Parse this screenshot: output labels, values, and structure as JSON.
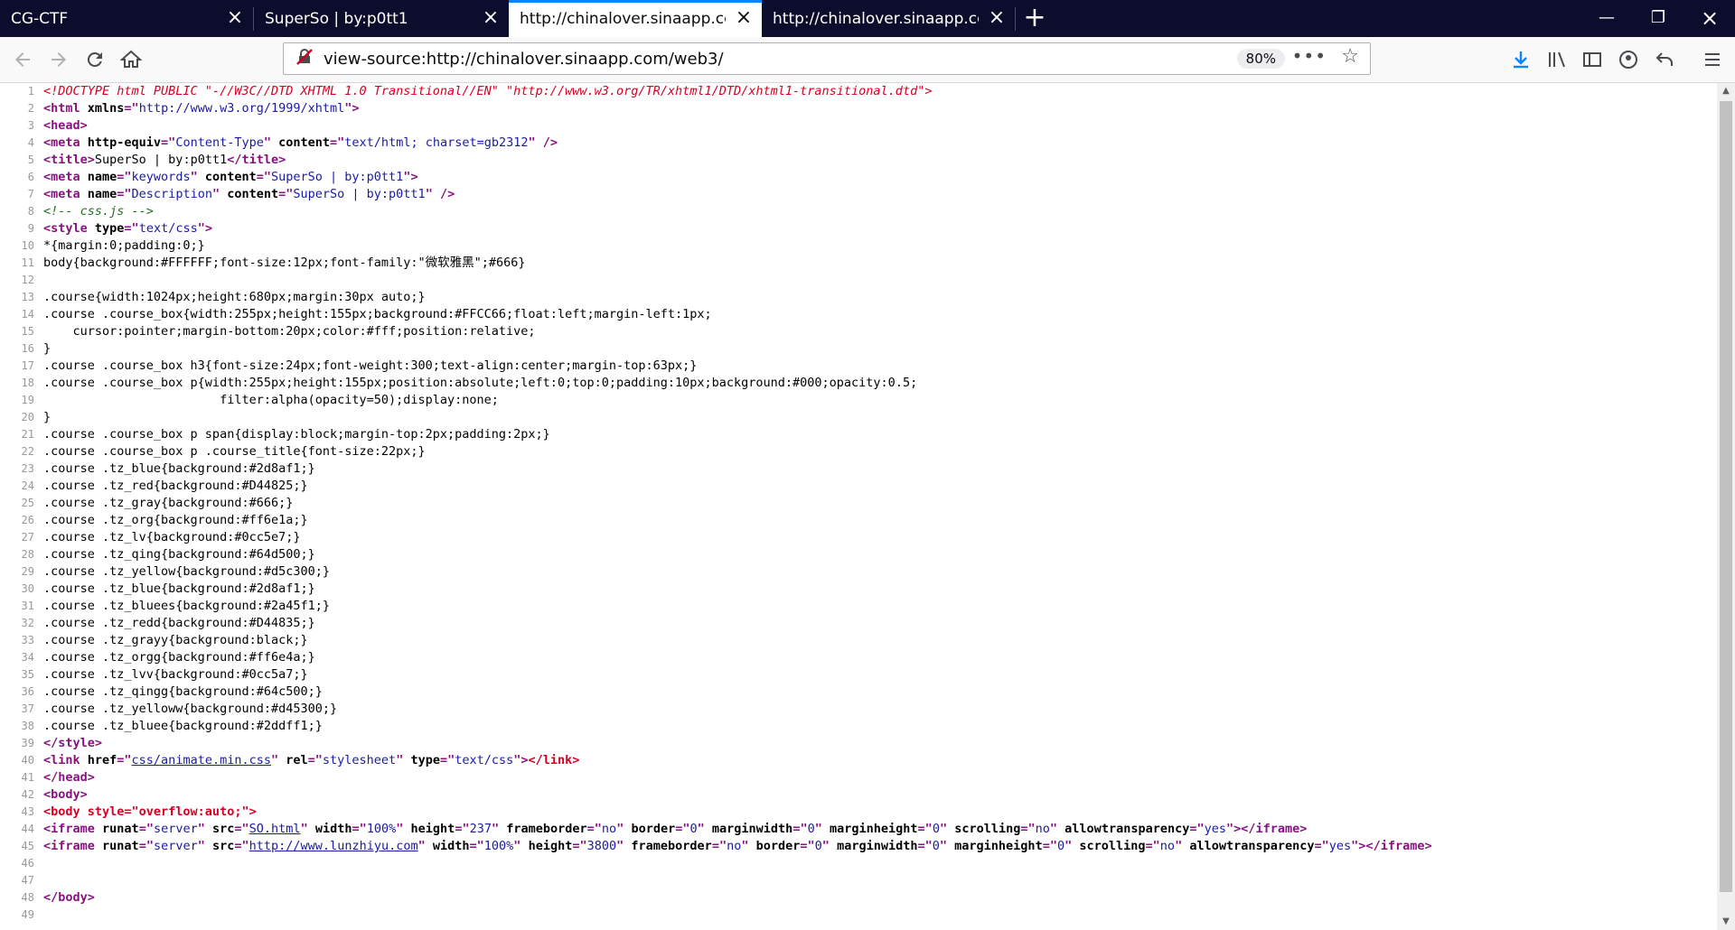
{
  "tabs": [
    {
      "label": "CG-CTF",
      "active": false
    },
    {
      "label": "SuperSo | by:p0tt1",
      "active": false
    },
    {
      "label": "http://chinalover.sinaapp.com/w",
      "active": true
    },
    {
      "label": "http://chinalover.sinaapp.com/w",
      "active": false
    }
  ],
  "toolbar": {
    "url": "view-source:http://chinalover.sinaapp.com/web3/",
    "zoom": "80%",
    "back_icon": "arrow-left-icon",
    "forward_icon": "arrow-right-icon",
    "reload_icon": "reload-icon",
    "home_icon": "home-icon"
  },
  "source_lines": [
    {
      "n": "1"
    },
    {
      "n": "2"
    },
    {
      "n": "3"
    },
    {
      "n": "4"
    },
    {
      "n": "5"
    },
    {
      "n": "6"
    },
    {
      "n": "7"
    },
    {
      "n": "8"
    },
    {
      "n": "9"
    },
    {
      "n": "10"
    },
    {
      "n": "11"
    },
    {
      "n": "12"
    },
    {
      "n": "13"
    },
    {
      "n": "14"
    },
    {
      "n": "15"
    },
    {
      "n": "16"
    },
    {
      "n": "17"
    },
    {
      "n": "18"
    },
    {
      "n": "19"
    },
    {
      "n": "20"
    },
    {
      "n": "21"
    },
    {
      "n": "22"
    },
    {
      "n": "23"
    },
    {
      "n": "24"
    },
    {
      "n": "25"
    },
    {
      "n": "26"
    },
    {
      "n": "27"
    },
    {
      "n": "28"
    },
    {
      "n": "29"
    },
    {
      "n": "30"
    },
    {
      "n": "31"
    },
    {
      "n": "32"
    },
    {
      "n": "33"
    },
    {
      "n": "34"
    },
    {
      "n": "35"
    },
    {
      "n": "36"
    },
    {
      "n": "37"
    },
    {
      "n": "38"
    },
    {
      "n": "39"
    },
    {
      "n": "40"
    },
    {
      "n": "41"
    },
    {
      "n": "42"
    },
    {
      "n": "43"
    },
    {
      "n": "44"
    },
    {
      "n": "45"
    },
    {
      "n": "46"
    },
    {
      "n": "47"
    },
    {
      "n": "48"
    },
    {
      "n": "49"
    }
  ],
  "code": {
    "l1": "<!DOCTYPE html PUBLIC \"-//W3C//DTD XHTML 1.0 Transitional//EN\" \"http://www.w3.org/TR/xhtml1/DTD/xhtml1-transitional.dtd\">",
    "l2_a": "<html",
    "l2_b": " xmlns",
    "l2_c": "=\"",
    "l2_d": "http://www.w3.org/1999/xhtml",
    "l2_e": "\">",
    "l3": "<head>",
    "l4_a": "<meta",
    "l4_b": " http-equiv",
    "l4_c": "=\"",
    "l4_d": "Content-Type",
    "l4_e": "\"",
    "l4_f": " content",
    "l4_g": "=\"",
    "l4_h": "text/html; charset=gb2312",
    "l4_i": "\" />",
    "l5_a": "<title>",
    "l5_b": "SuperSo | by:p0tt1",
    "l5_c": "</title>",
    "l6_a": "<meta",
    "l6_b": " name",
    "l6_c": "=\"",
    "l6_d": "keywords",
    "l6_e": "\"",
    "l6_f": " content",
    "l6_g": "=\"",
    "l6_h": "SuperSo | by:p0tt1",
    "l6_i": "\">",
    "l7_a": "<meta",
    "l7_b": " name",
    "l7_c": "=\"",
    "l7_d": "Description",
    "l7_e": "\"",
    "l7_f": " content",
    "l7_g": "=\"",
    "l7_h": "SuperSo | by:p0tt1",
    "l7_i": "\" />",
    "l8": "<!-- css.js -->",
    "l9_a": "<style",
    "l9_b": " type",
    "l9_c": "=\"",
    "l9_d": "text/css",
    "l9_e": "\">",
    "l10": "*{margin:0;padding:0;}",
    "l11": "body{background:#FFFFFF;font-size:12px;font-family:\"微软雅黑\";#666}",
    "l13": ".course{width:1024px;height:680px;margin:30px auto;}",
    "l14": ".course .course_box{width:255px;height:155px;background:#FFCC66;float:left;margin-left:1px;",
    "l15": "    cursor:pointer;margin-bottom:20px;color:#fff;position:relative;",
    "l16": "}",
    "l17": ".course .course_box h3{font-size:24px;font-weight:300;text-align:center;margin-top:63px;}",
    "l18": ".course .course_box p{width:255px;height:155px;position:absolute;left:0;top:0;padding:10px;background:#000;opacity:0.5;",
    "l19": "                        filter:alpha(opacity=50);display:none;",
    "l20": "}",
    "l21": ".course .course_box p span{display:block;margin-top:2px;padding:2px;}",
    "l22": ".course .course_box p .course_title{font-size:22px;}",
    "l23": ".course .tz_blue{background:#2d8af1;}",
    "l24": ".course .tz_red{background:#D44825;}",
    "l25": ".course .tz_gray{background:#666;}",
    "l26": ".course .tz_org{background:#ff6e1a;}",
    "l27": ".course .tz_lv{background:#0cc5e7;}",
    "l28": ".course .tz_qing{background:#64d500;}",
    "l29": ".course .tz_yellow{background:#d5c300;}",
    "l30": ".course .tz_blue{background:#2d8af1;}",
    "l31": ".course .tz_bluees{background:#2a45f1;}",
    "l32": ".course .tz_redd{background:#D44835;}",
    "l33": ".course .tz_grayy{background:black;}",
    "l34": ".course .tz_orgg{background:#ff6e4a;}",
    "l35": ".course .tz_lvv{background:#0cc5a7;}",
    "l36": ".course .tz_qingg{background:#64c500;}",
    "l37": ".course .tz_yelloww{background:#d45300;}",
    "l38": ".course .tz_bluee{background:#2ddff1;}",
    "l39": "</style>",
    "l40_a": "<link",
    "l40_b": " href",
    "l40_c": "=\"",
    "l40_d": "css/animate.min.css",
    "l40_e": "\"",
    "l40_f": " rel",
    "l40_g": "=\"",
    "l40_h": "stylesheet",
    "l40_i": "\"",
    "l40_j": " type",
    "l40_k": "=\"",
    "l40_l": "text/css",
    "l40_m": "\">",
    "l40_n": "</link>",
    "l41": "</head>",
    "l42": "<body>",
    "l43": "<body style=\"overflow:auto;\">",
    "l44_a": "<iframe",
    "l44_b": " runat",
    "l44_c": "=\"",
    "l44_d": "server",
    "l44_e": "\"",
    "l44_f": " src",
    "l44_g": "=\"",
    "l44_h": "SO.html",
    "l44_i": "\"",
    "l44_j": " width",
    "l44_k": "=\"",
    "l44_l": "100%",
    "l44_m": "\"",
    "l44_n": " height",
    "l44_o": "=\"",
    "l44_p": "237",
    "l44_q": "\"",
    "l44_r": " frameborder",
    "l44_s": "=\"",
    "l44_t": "no",
    "l44_u": "\"",
    "l44_v": " border",
    "l44_w": "=\"",
    "l44_x": "0",
    "l44_y": "\"",
    "l44_z": " marginwidth",
    "l44_aa": "=\"",
    "l44_ab": "0",
    "l44_ac": "\"",
    "l44_ad": " marginheight",
    "l44_ae": "=\"",
    "l44_af": "0",
    "l44_ag": "\"",
    "l44_ah": " scrolling",
    "l44_ai": "=\"",
    "l44_aj": "no",
    "l44_ak": "\"",
    "l44_al": " allowtransparency",
    "l44_am": "=\"",
    "l44_an": "yes",
    "l44_ao": "\">",
    "l44_ap": "</iframe>",
    "l45_a": "<iframe",
    "l45_b": " runat",
    "l45_c": "=\"",
    "l45_d": "server",
    "l45_e": "\"",
    "l45_f": " src",
    "l45_g": "=\"",
    "l45_h": "http://www.lunzhiyu.com",
    "l45_i": "\"",
    "l45_j": " width",
    "l45_k": "=\"",
    "l45_l": "100%",
    "l45_m": "\"",
    "l45_n": " height",
    "l45_o": "=\"",
    "l45_p": "3800",
    "l45_q": "\"",
    "l45_r": " frameborder",
    "l45_s": "=\"",
    "l45_t": "no",
    "l45_u": "\"",
    "l45_v": " border",
    "l45_w": "=\"",
    "l45_x": "0",
    "l45_y": "\"",
    "l45_z": " marginwidth",
    "l45_aa": "=\"",
    "l45_ab": "0",
    "l45_ac": "\"",
    "l45_ad": " marginheight",
    "l45_ae": "=\"",
    "l45_af": "0",
    "l45_ag": "\"",
    "l45_ah": " scrolling",
    "l45_ai": "=\"",
    "l45_aj": "no",
    "l45_ak": "\"",
    "l45_al": " allowtransparency",
    "l45_am": "=\"",
    "l45_an": "yes",
    "l45_ao": "\">",
    "l45_ap": "</iframe>",
    "l48": "</body>"
  }
}
